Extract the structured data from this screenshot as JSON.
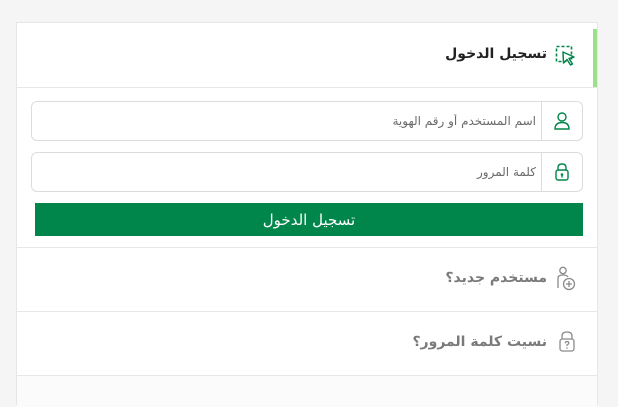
{
  "login": {
    "title": "تسجيل الدخول",
    "username_placeholder": "اسم المستخدم أو رقم الهوية",
    "password_placeholder": "كلمة المرور",
    "submit_label": "تسجيل الدخول"
  },
  "links": {
    "new_user": "مستخدم جديد؟",
    "forgot_password": "نسيت كلمة المرور؟"
  },
  "colors": {
    "primary_green": "#00854a",
    "accent_light_green": "#9be08a"
  },
  "icons": {
    "header": "cursor-select-icon",
    "username": "user-icon",
    "password": "lock-icon",
    "new_user": "add-user-icon",
    "forgot_password": "lock-question-icon"
  }
}
